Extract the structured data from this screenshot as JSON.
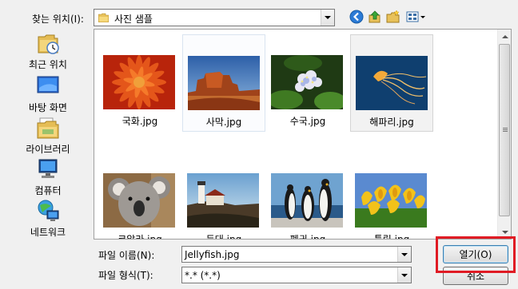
{
  "lookin": {
    "label": "찾는 위치(I):",
    "value": "사진 샘플"
  },
  "toolbar": {
    "icons": [
      "back-icon",
      "up-folder-icon",
      "new-folder-icon",
      "view-menu-icon"
    ]
  },
  "places": [
    {
      "label": "최근 위치",
      "icon": "recent-places-icon"
    },
    {
      "label": "바탕 화면",
      "icon": "desktop-icon"
    },
    {
      "label": "라이브러리",
      "icon": "libraries-icon"
    },
    {
      "label": "컴퓨터",
      "icon": "computer-icon"
    },
    {
      "label": "네트워크",
      "icon": "network-icon"
    }
  ],
  "files": [
    {
      "name": "국화.jpg",
      "thumb": "chrysanthemum"
    },
    {
      "name": "사막.jpg",
      "thumb": "desert"
    },
    {
      "name": "수국.jpg",
      "thumb": "hydrangeas"
    },
    {
      "name": "해파리.jpg",
      "thumb": "jellyfish"
    },
    {
      "name": "코알라.jpg",
      "thumb": "koala"
    },
    {
      "name": "등대.jpg",
      "thumb": "lighthouse"
    },
    {
      "name": "펭귄.jpg",
      "thumb": "penguins"
    },
    {
      "name": "튤립.jpg",
      "thumb": "tulips"
    }
  ],
  "filename": {
    "label": "파일 이름(N):",
    "value": "Jellyfish.jpg"
  },
  "filetype": {
    "label": "파일 형식(T):",
    "value": "*.* (*.*)"
  },
  "buttons": {
    "open": "열기(O)",
    "cancel": "취소"
  },
  "colors": {
    "highlight_box": "#e01b24",
    "default_button_border": "#3c7fb1"
  }
}
